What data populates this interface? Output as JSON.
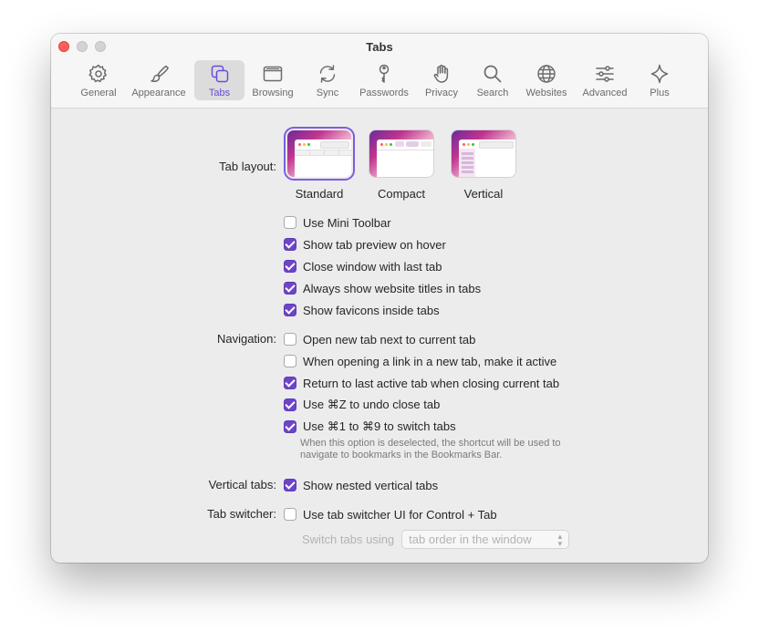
{
  "window": {
    "title": "Tabs"
  },
  "toolbar": {
    "items": [
      {
        "label": "General",
        "icon": "gear-icon"
      },
      {
        "label": "Appearance",
        "icon": "paintbrush-icon"
      },
      {
        "label": "Tabs",
        "icon": "tabs-icon",
        "selected": true
      },
      {
        "label": "Browsing",
        "icon": "browser-window-icon"
      },
      {
        "label": "Sync",
        "icon": "sync-icon"
      },
      {
        "label": "Passwords",
        "icon": "key-icon"
      },
      {
        "label": "Privacy",
        "icon": "hand-icon"
      },
      {
        "label": "Search",
        "icon": "search-icon"
      },
      {
        "label": "Websites",
        "icon": "globe-icon"
      },
      {
        "label": "Advanced",
        "icon": "sliders-icon"
      },
      {
        "label": "Plus",
        "icon": "sparkle-icon"
      }
    ]
  },
  "tab_layout": {
    "label": "Tab layout:",
    "options": [
      {
        "label": "Standard",
        "selected": true
      },
      {
        "label": "Compact",
        "selected": false
      },
      {
        "label": "Vertical",
        "selected": false
      }
    ]
  },
  "tab_options": [
    {
      "label": "Use Mini Toolbar",
      "checked": false
    },
    {
      "label": "Show tab preview on hover",
      "checked": true
    },
    {
      "label": "Close window with last tab",
      "checked": true
    },
    {
      "label": "Always show website titles in tabs",
      "checked": true
    },
    {
      "label": "Show favicons inside tabs",
      "checked": true
    }
  ],
  "navigation": {
    "label": "Navigation:",
    "options": [
      {
        "label": "Open new tab next to current tab",
        "checked": false
      },
      {
        "label": "When opening a link in a new tab, make it active",
        "checked": false
      },
      {
        "label": "Return to last active tab when closing current tab",
        "checked": true
      },
      {
        "label": "Use ⌘Z to undo close tab",
        "checked": true
      },
      {
        "label": "Use ⌘1 to ⌘9 to switch tabs",
        "checked": true
      }
    ],
    "note": "When this option is deselected, the shortcut will be used to navigate to bookmarks in the Bookmarks Bar."
  },
  "vertical_tabs": {
    "label": "Vertical tabs:",
    "option": {
      "label": "Show nested vertical tabs",
      "checked": true
    }
  },
  "tab_switcher": {
    "label": "Tab switcher:",
    "option": {
      "label": "Use tab switcher UI for Control + Tab",
      "checked": false
    },
    "switch_label": "Switch tabs using",
    "switch_value": "tab order in the window"
  },
  "colors": {
    "accent": "#6d45c9",
    "selected_icon": "#6a4bdc"
  }
}
